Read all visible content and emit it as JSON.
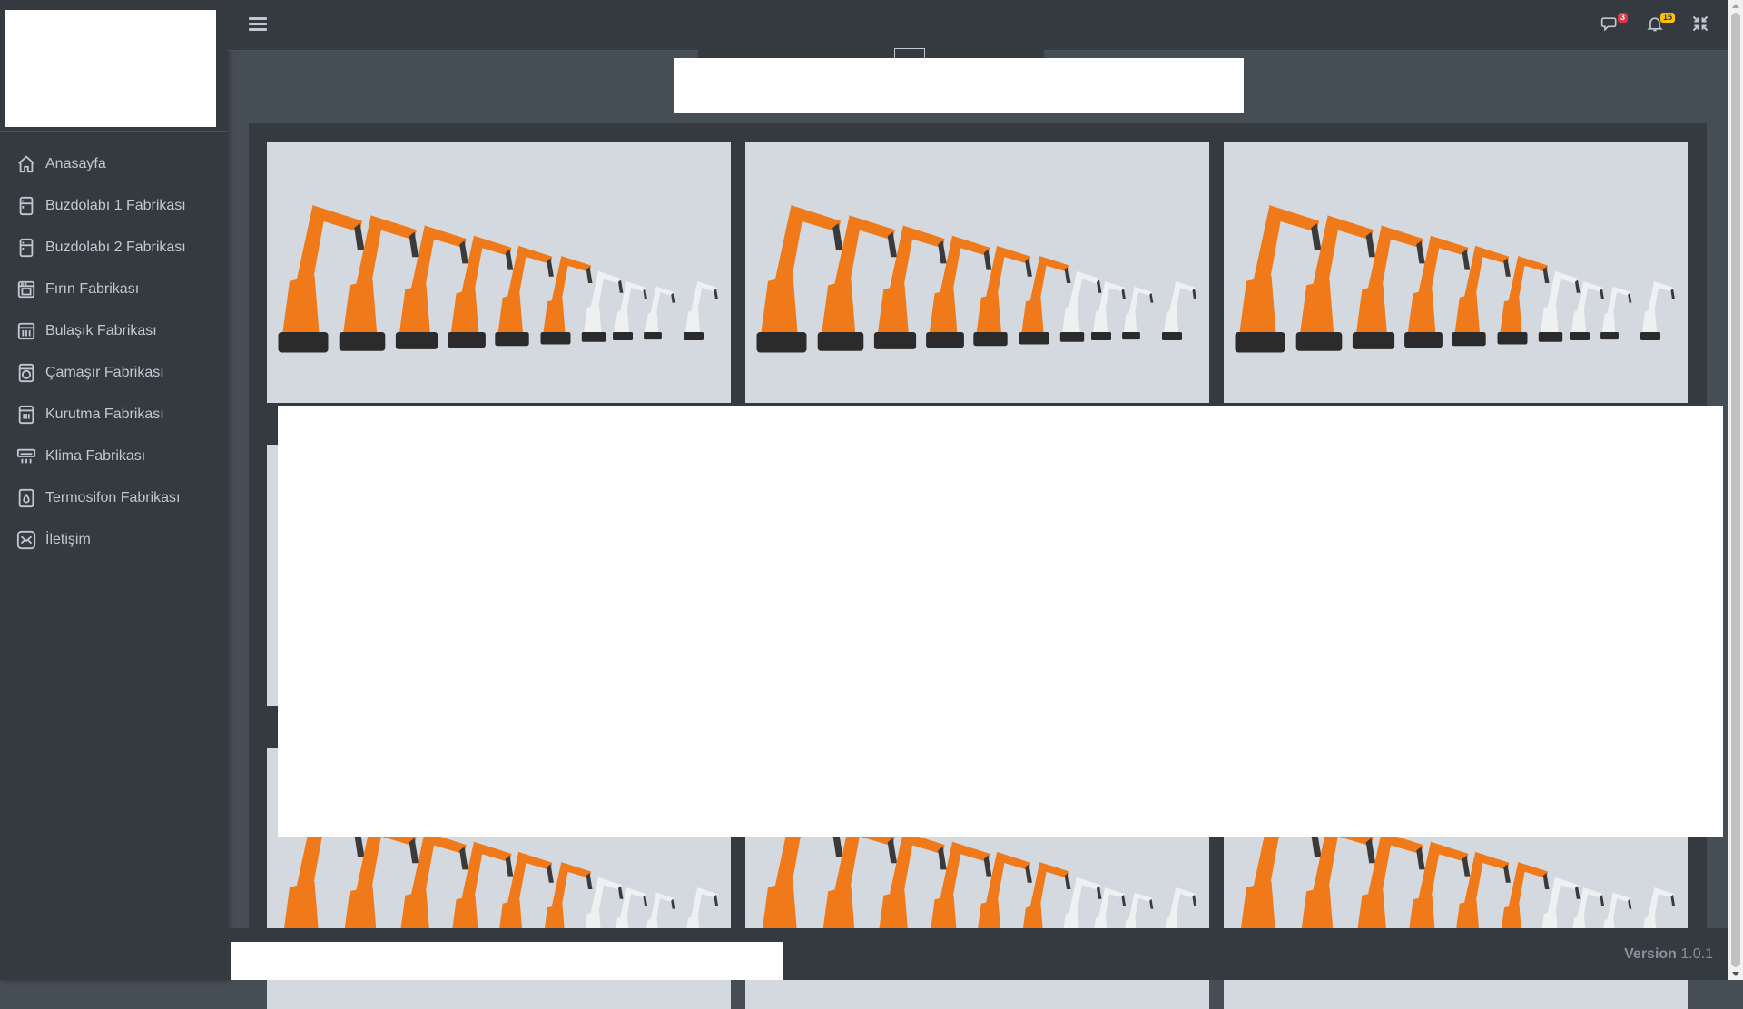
{
  "sidebar": {
    "items": [
      {
        "label": "Anasayfa",
        "icon": "home-icon"
      },
      {
        "label": "Buzdolabı 1 Fabrikası",
        "icon": "fridge-icon"
      },
      {
        "label": "Buzdolabı 2 Fabrikası",
        "icon": "fridge-icon"
      },
      {
        "label": "Fırın Fabrikası",
        "icon": "oven-icon"
      },
      {
        "label": "Bulaşık Fabrikası",
        "icon": "dishwasher-icon"
      },
      {
        "label": "Çamaşır Fabrikası",
        "icon": "washing-machine-icon"
      },
      {
        "label": "Kurutma Fabrikası",
        "icon": "dryer-icon"
      },
      {
        "label": "Klima Fabrikası",
        "icon": "air-conditioner-icon"
      },
      {
        "label": "Termosifon Fabrikası",
        "icon": "water-heater-icon"
      },
      {
        "label": "İletişim",
        "icon": "mail-icon"
      }
    ]
  },
  "header": {
    "messages_badge": "3",
    "notifications_badge": "15"
  },
  "gallery": {
    "image_subject": "orange industrial robot arms lineup",
    "colors": {
      "robot": "#f07a1a",
      "background": "#d3d9de"
    }
  },
  "footer": {
    "version_label": "Version",
    "version_number": "1.0.1"
  }
}
